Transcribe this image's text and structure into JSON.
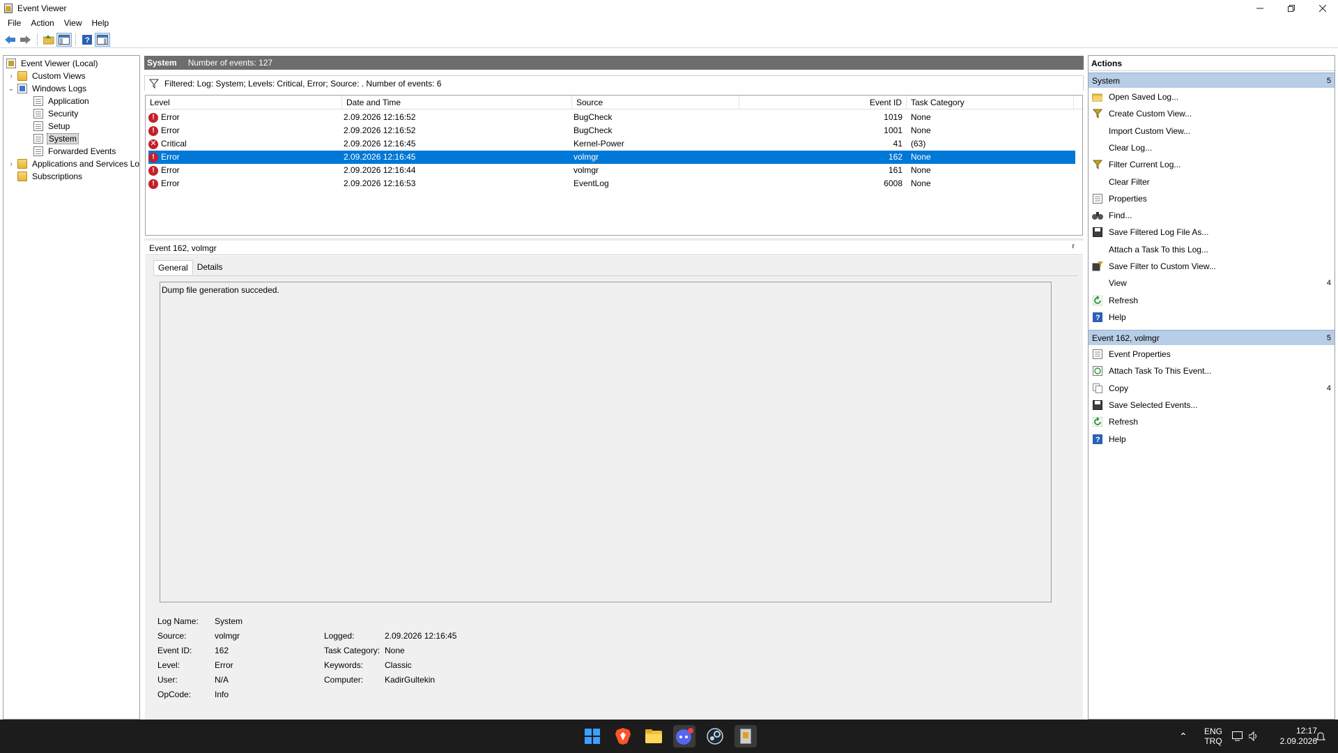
{
  "window": {
    "title": "Event Viewer",
    "controls": [
      "minimize",
      "restore",
      "close"
    ]
  },
  "menu": [
    "File",
    "Action",
    "View",
    "Help"
  ],
  "toolbar": {
    "buttons": [
      "back-icon",
      "forward-icon",
      "up-folder-icon",
      "show-hide-tree-icon",
      "help-icon",
      "show-hide-action-pane-icon"
    ]
  },
  "tree": {
    "root": "Event Viewer (Local)",
    "custom_views": "Custom Views",
    "windows_logs": "Windows Logs",
    "application": "Application",
    "security": "Security",
    "setup": "Setup",
    "system": "System",
    "forwarded": "Forwarded Events",
    "apps_services": "Applications and Services Lo",
    "subscriptions": "Subscriptions"
  },
  "center": {
    "header_name": "System",
    "header_count": "Number of events: 127",
    "filter_text": "Filtered: Log: System; Levels: Critical, Error; Source: . Number of events: 6",
    "columns": [
      "Level",
      "Date and Time",
      "Source",
      "Event ID",
      "Task Category"
    ],
    "rows": [
      {
        "level": "Error",
        "datetime": "2.09.2026 12:16:52",
        "source": "BugCheck",
        "event_id": "1019",
        "task": "None",
        "selected": false
      },
      {
        "level": "Error",
        "datetime": "2.09.2026 12:16:52",
        "source": "BugCheck",
        "event_id": "1001",
        "task": "None",
        "selected": false
      },
      {
        "level": "Critical",
        "datetime": "2.09.2026 12:16:45",
        "source": "Kernel-Power",
        "event_id": "41",
        "task": "(63)",
        "selected": false
      },
      {
        "level": "Error",
        "datetime": "2.09.2026 12:16:45",
        "source": "volmgr",
        "event_id": "162",
        "task": "None",
        "selected": true
      },
      {
        "level": "Error",
        "datetime": "2.09.2026 12:16:44",
        "source": "volmgr",
        "event_id": "161",
        "task": "None",
        "selected": false
      },
      {
        "level": "Error",
        "datetime": "2.09.2026 12:16:53",
        "source": "EventLog",
        "event_id": "6008",
        "task": "None",
        "selected": false
      }
    ]
  },
  "detail": {
    "title": "Event 162, volmgr",
    "close_glyph": "r",
    "tabs": [
      "General",
      "Details"
    ],
    "description": "Dump file generation succeded.",
    "props": {
      "log_name_label": "Log Name:",
      "log_name": "System",
      "source_label": "Source:",
      "source": "volmgr",
      "event_id_label": "Event ID:",
      "event_id": "162",
      "level_label": "Level:",
      "level": "Error",
      "user_label": "User:",
      "user": "N/A",
      "opcode_label": "OpCode:",
      "opcode": "Info",
      "logged_label": "Logged:",
      "logged": "2.09.2026 12:16:45",
      "task_category_label": "Task Category:",
      "task_category": "None",
      "keywords_label": "Keywords:",
      "keywords": "Classic",
      "computer_label": "Computer:",
      "computer": "KadirGultekin"
    }
  },
  "actions": {
    "title": "Actions",
    "section1": "System",
    "section1_arrow": "5",
    "items1": [
      {
        "label": "Open Saved Log...",
        "icon": "open-folder-icon"
      },
      {
        "label": "Create Custom View...",
        "icon": "filter-icon"
      },
      {
        "label": "Import Custom View...",
        "icon": ""
      },
      {
        "label": "Clear Log...",
        "icon": ""
      },
      {
        "label": "Filter Current Log...",
        "icon": "filter-icon"
      },
      {
        "label": "Clear Filter",
        "icon": ""
      },
      {
        "label": "Properties",
        "icon": "properties-icon"
      },
      {
        "label": "Find...",
        "icon": "binoculars-icon"
      },
      {
        "label": "Save Filtered Log File As...",
        "icon": "save-icon"
      },
      {
        "label": "Attach a Task To this Log...",
        "icon": ""
      },
      {
        "label": "Save Filter to Custom View...",
        "icon": "save-filter-icon"
      },
      {
        "label": "View",
        "icon": "",
        "sub": "4"
      },
      {
        "label": "Refresh",
        "icon": "refresh-icon"
      },
      {
        "label": "Help",
        "icon": "help-icon"
      }
    ],
    "section2": "Event 162, volmgr",
    "section2_arrow": "5",
    "items2": [
      {
        "label": "Event Properties",
        "icon": "properties-icon"
      },
      {
        "label": "Attach Task To This Event...",
        "icon": "task-icon"
      },
      {
        "label": "Copy",
        "icon": "copy-icon",
        "sub": "4"
      },
      {
        "label": "Save Selected Events...",
        "icon": "save-icon"
      },
      {
        "label": "Refresh",
        "icon": "refresh-icon"
      },
      {
        "label": "Help",
        "icon": "help-icon"
      }
    ]
  },
  "taskbar": {
    "apps": [
      "windows-start-icon",
      "brave-browser-icon",
      "file-explorer-icon",
      "discord-icon",
      "steam-icon",
      "event-viewer-taskbar-icon"
    ],
    "lang_top": "ENG",
    "lang_bottom": "TRQ",
    "time": "12:17",
    "date": "2.09.2026"
  },
  "colors": {
    "selection": "#0078d7",
    "section_header": "#b8cde6",
    "error": "#c4202a",
    "taskbar": "#1c1c1c"
  }
}
